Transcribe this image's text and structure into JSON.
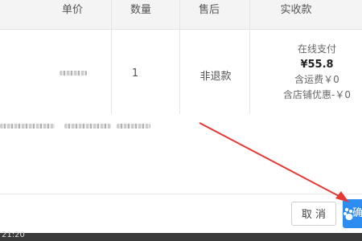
{
  "table": {
    "headers": [
      "单价",
      "数量",
      "售后",
      "实收款"
    ],
    "row": {
      "quantity": "1",
      "after_sale": "非退款",
      "payment": {
        "method": "在线支付",
        "amount": "¥55.8",
        "shipping": "含运费￥0",
        "shop_discount": "含店铺优惠-￥0"
      }
    }
  },
  "footer": {
    "cancel_label": "取 消",
    "primary_label": "确"
  },
  "taskbar": {
    "time": "21:20"
  },
  "colors": {
    "primary": "#2d8cf0",
    "annotation_arrow": "#e53935"
  }
}
